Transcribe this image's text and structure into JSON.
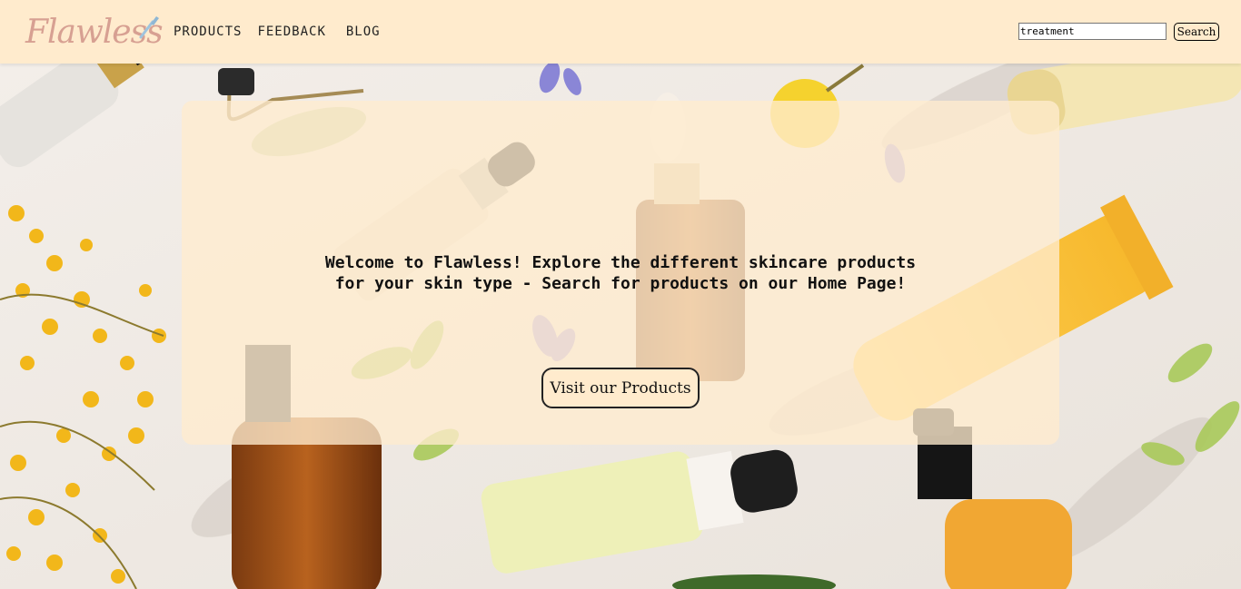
{
  "brand": {
    "logo_text": "Flawless"
  },
  "nav": {
    "items": [
      {
        "label": "PRODUCTS"
      },
      {
        "label": "FEEDBACK"
      },
      {
        "label": "BLOG"
      }
    ]
  },
  "search": {
    "value": "treatment",
    "button_label": "Search"
  },
  "hero": {
    "welcome_line1": "Welcome to Flawless! Explore the different skincare products",
    "welcome_line2": "for your skin type - Search for products on our Home Page!",
    "cta_label": "Visit our Products"
  },
  "colors": {
    "header_bg": "#ffebcd",
    "panel_bg": "#ffeccd",
    "logo": "#d7a092",
    "text": "#111111"
  }
}
